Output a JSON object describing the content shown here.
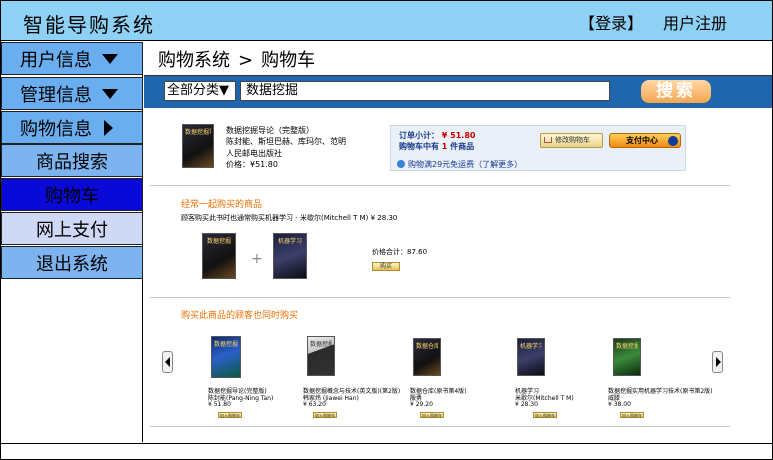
{
  "header": {
    "app_title": "智能导购系统",
    "login_label": "【登录】",
    "register_label": "用户注册"
  },
  "sidebar": {
    "items": [
      {
        "label": "用户信息",
        "type": "main",
        "indicator": "chevron-down-icon"
      },
      {
        "label": "管理信息",
        "type": "main",
        "indicator": "chevron-down-icon"
      },
      {
        "label": "购物信息",
        "type": "main",
        "indicator": "chevron-right-icon"
      },
      {
        "label": "商品搜索",
        "type": "sub",
        "state": "normal"
      },
      {
        "label": "购物车",
        "type": "sub",
        "state": "active"
      },
      {
        "label": "网上支付",
        "type": "sub",
        "state": "light"
      },
      {
        "label": "退出系统",
        "type": "sub",
        "state": "normal"
      }
    ]
  },
  "breadcrumb": {
    "root": "购物系统",
    "separator": ">",
    "current": "购物车"
  },
  "search": {
    "category_value": "全部分类▼",
    "query_value": "数据挖掘",
    "button_label": "搜索"
  },
  "cart": {
    "book": {
      "cover_text": "数据挖掘导论",
      "title": "数据挖掘导论（完整版）",
      "authors": "陈封能、斯坦巴赫、库玛尔、范明",
      "publisher": "人民邮电出版社",
      "price": "价格：¥51.80"
    },
    "summary": {
      "subtotal_label": "订单小计：",
      "subtotal_value": "¥ 51.80",
      "count_text_prefix": "购物车中有",
      "count_value": "1",
      "count_text_suffix": "件商品",
      "edit_button_label": "修改购物车",
      "checkout_button_label": "支付中心",
      "shipping_note": "购物满29元免运费（了解更多）"
    }
  },
  "bundle": {
    "section_title": "经常一起购买的商品",
    "caption": "顾客购买此书时也通常购买机器学习 - 米歇尔(Mitchell T M) ¥ 28.30",
    "book1_cover": "数据挖掘",
    "book2_cover": "机器学习",
    "total_text": "价格合计：87.60",
    "buy_label": "购买"
  },
  "recommendations": {
    "section_title": "购买此商品的顾客也同时购买",
    "items": [
      {
        "cover": "数据挖掘",
        "title": "数据挖掘导论(完整版)",
        "author": "陈封能(Pang-Ning Tan)",
        "price": "¥ 51.80",
        "button": "加入购物车"
      },
      {
        "cover": "数据挖掘",
        "title": "数据挖掘概念与技术(英文版)(第2版)",
        "author": "韩家炜 (Jiawei Han)",
        "price": "¥ 63.20",
        "button": "加入购物车"
      },
      {
        "cover": "数据仓库",
        "title": "数据仓库(原书第4版)",
        "author": "殷勇",
        "price": "¥ 29.20",
        "button": "加入购物车"
      },
      {
        "cover": "机器学习",
        "title": "机器学习",
        "author": "米歇尔(Mitchell T M)",
        "price": "¥ 28.30",
        "button": "加入购物车"
      },
      {
        "cover": "数据挖掘",
        "title": "数据挖掘实用机器学习技术(原书第2版)",
        "author": "威滕",
        "price": "¥ 38.00",
        "button": "加入购物车"
      }
    ]
  },
  "colors": {
    "header_bg": "#8fd0f5",
    "search_bar_bg": "#1f66ad",
    "menu_main_bg": "#6aaef0",
    "menu_active_bg": "#0a0ad8",
    "section_title": "#e37000",
    "search_button": "#f5a64e"
  }
}
